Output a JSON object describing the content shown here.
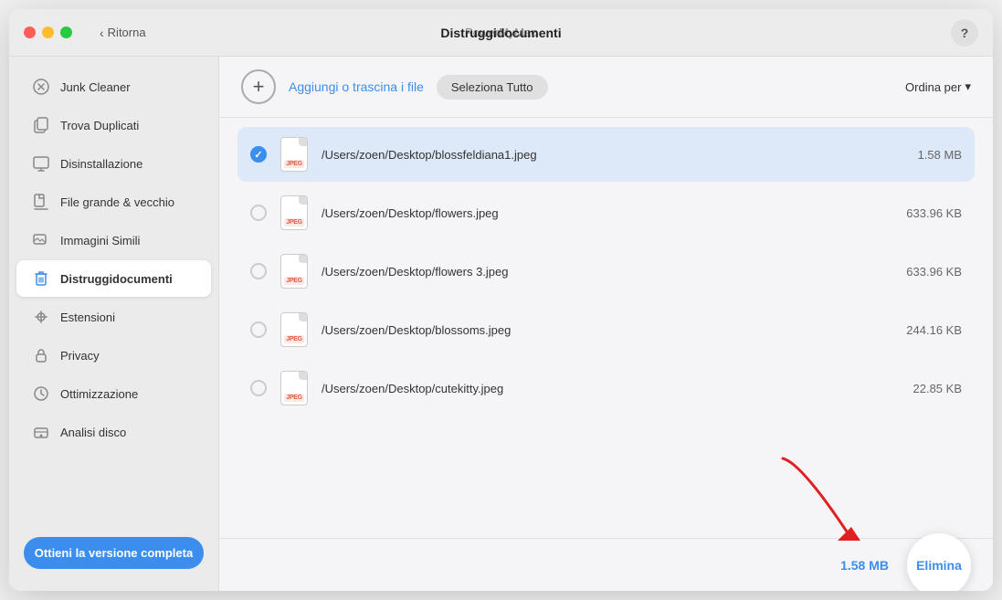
{
  "app": {
    "name": "PowerMyMac"
  },
  "titlebar": {
    "back_label": "Ritorna",
    "center_title": "Distruggidocumenti",
    "help_label": "?"
  },
  "sidebar": {
    "items": [
      {
        "id": "junk-cleaner",
        "label": "Junk Cleaner",
        "active": false
      },
      {
        "id": "trova-duplicati",
        "label": "Trova Duplicati",
        "active": false
      },
      {
        "id": "disinstallazione",
        "label": "Disinstallazione",
        "active": false
      },
      {
        "id": "file-grande",
        "label": "File grande & vecchio",
        "active": false
      },
      {
        "id": "immagini-simili",
        "label": "Immagini Simili",
        "active": false
      },
      {
        "id": "distruggidocumenti",
        "label": "Distruggidocumenti",
        "active": true
      },
      {
        "id": "estensioni",
        "label": "Estensioni",
        "active": false
      },
      {
        "id": "privacy",
        "label": "Privacy",
        "active": false
      },
      {
        "id": "ottimizzazione",
        "label": "Ottimizzazione",
        "active": false
      },
      {
        "id": "analisi-disco",
        "label": "Analisi disco",
        "active": false
      }
    ],
    "upgrade_label": "Ottieni la versione completa"
  },
  "toolbar": {
    "add_label": "Aggiungi o trascina i file",
    "select_all_label": "Seleziona Tutto",
    "sort_label": "Ordina per"
  },
  "files": [
    {
      "path": "/Users/zoen/Desktop/blossfeldiana1.jpeg",
      "size": "1.58 MB",
      "selected": true
    },
    {
      "path": "/Users/zoen/Desktop/flowers.jpeg",
      "size": "633.96 KB",
      "selected": false
    },
    {
      "path": "/Users/zoen/Desktop/flowers 3.jpeg",
      "size": "633.96 KB",
      "selected": false
    },
    {
      "path": "/Users/zoen/Desktop/blossoms.jpeg",
      "size": "244.16 KB",
      "selected": false
    },
    {
      "path": "/Users/zoen/Desktop/cutekitty.jpeg",
      "size": "22.85 KB",
      "selected": false
    }
  ],
  "bottom": {
    "total_size": "1.58 MB",
    "delete_label": "Elimina"
  },
  "colors": {
    "accent": "#3b8eed",
    "red_arrow": "#e02020"
  }
}
